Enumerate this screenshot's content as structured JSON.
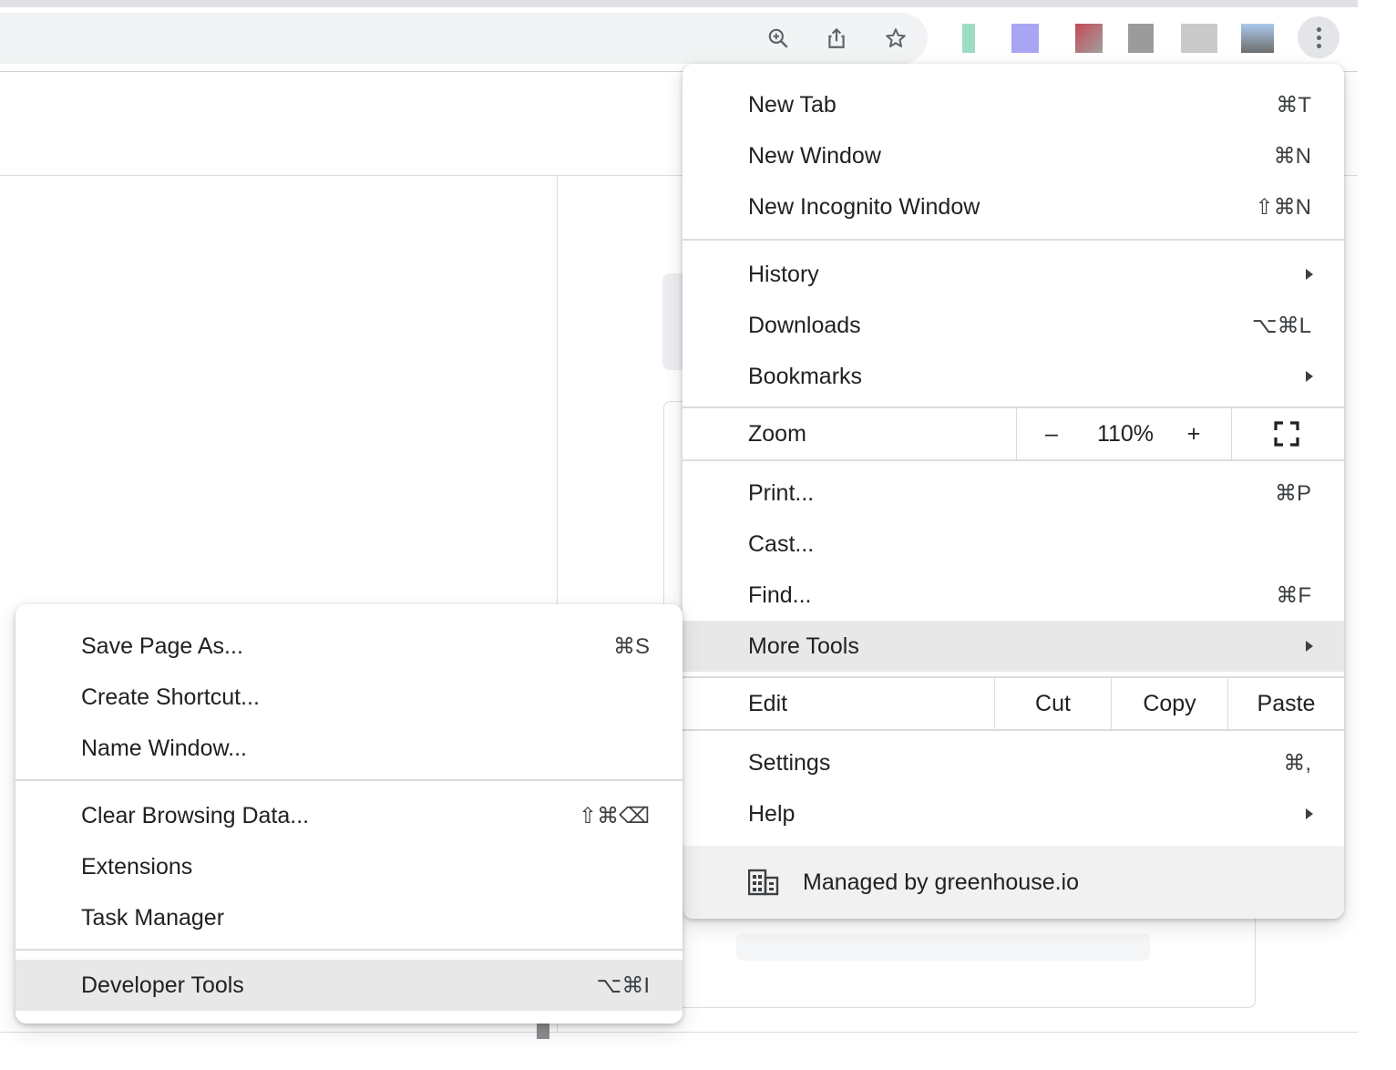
{
  "toolbar": {
    "icons": [
      "zoom-icon",
      "share-icon",
      "bookmark-star-icon",
      "more-options-icon"
    ],
    "extensions": [
      "extension-1",
      "extension-2",
      "extension-3",
      "extension-4",
      "extension-5",
      "extension-6"
    ]
  },
  "main_menu": {
    "items": [
      {
        "label": "New Tab",
        "shortcut": "⌘T"
      },
      {
        "label": "New Window",
        "shortcut": "⌘N"
      },
      {
        "label": "New Incognito Window",
        "shortcut": "⇧⌘N"
      },
      {
        "label": "History",
        "submenu": true
      },
      {
        "label": "Downloads",
        "shortcut": "⌥⌘L"
      },
      {
        "label": "Bookmarks",
        "submenu": true
      }
    ],
    "zoom": {
      "label": "Zoom",
      "minus": "–",
      "value": "110%",
      "plus": "+",
      "fullscreen_icon": "fullscreen-icon"
    },
    "items2": [
      {
        "label": "Print...",
        "shortcut": "⌘P"
      },
      {
        "label": "Cast...",
        "shortcut": ""
      },
      {
        "label": "Find...",
        "shortcut": "⌘F"
      },
      {
        "label": "More Tools",
        "submenu": true,
        "highlighted": true
      }
    ],
    "edit": {
      "label": "Edit",
      "cut": "Cut",
      "copy": "Copy",
      "paste": "Paste"
    },
    "items3": [
      {
        "label": "Settings",
        "shortcut": "⌘,"
      },
      {
        "label": "Help",
        "submenu": true
      }
    ],
    "managed": {
      "label": "Managed by greenhouse.io",
      "icon": "building-icon"
    }
  },
  "sub_menu": {
    "items": [
      {
        "label": "Save Page As...",
        "shortcut": "⌘S"
      },
      {
        "label": "Create Shortcut...",
        "shortcut": ""
      },
      {
        "label": "Name Window...",
        "shortcut": ""
      },
      {
        "label": "Clear Browsing Data...",
        "shortcut": "⇧⌘⌫"
      },
      {
        "label": "Extensions",
        "shortcut": ""
      },
      {
        "label": "Task Manager",
        "shortcut": ""
      },
      {
        "label": "Developer Tools",
        "shortcut": "⌥⌘I",
        "highlighted": true
      }
    ]
  },
  "colors": {
    "menu_bg": "#ffffff",
    "highlight": "#e8e8e9",
    "separator": "#dadce0",
    "managed_bg": "#f1f1f2"
  }
}
